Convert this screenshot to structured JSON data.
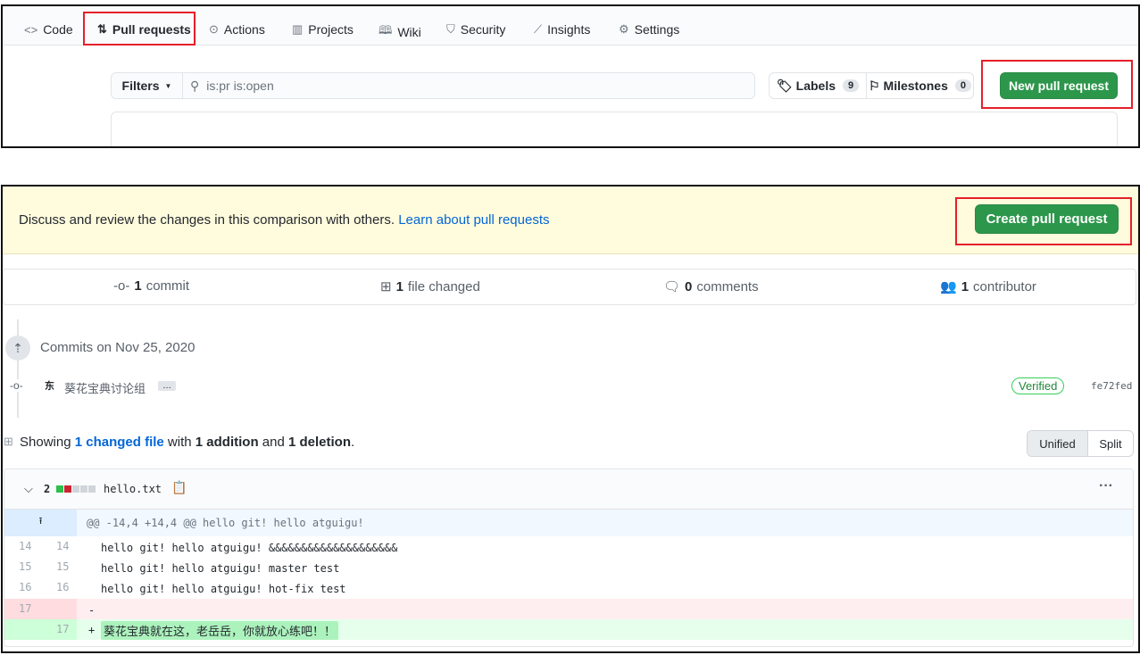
{
  "nav": {
    "tabs": [
      {
        "label": "Code",
        "icon": "code-icon"
      },
      {
        "label": "Pull requests",
        "icon": "git-pull-request-icon",
        "selected": true
      },
      {
        "label": "Actions",
        "icon": "play-icon"
      },
      {
        "label": "Projects",
        "icon": "project-icon"
      },
      {
        "label": "Wiki",
        "icon": "book-icon"
      },
      {
        "label": "Security",
        "icon": "shield-icon"
      },
      {
        "label": "Insights",
        "icon": "graph-icon"
      },
      {
        "label": "Settings",
        "icon": "gear-icon"
      }
    ]
  },
  "filters": {
    "label": "Filters",
    "search_value": "is:pr is:open"
  },
  "labels": {
    "label": "Labels",
    "count": "9"
  },
  "milestones": {
    "label": "Milestones",
    "count": "0"
  },
  "new_pr": "New pull request",
  "compare": {
    "banner_text": "Discuss and review the changes in this comparison with others.",
    "banner_link": "Learn about pull requests",
    "create_pr": "Create pull request"
  },
  "stats": {
    "commits_n": "1",
    "commits": "commit",
    "files_n": "1",
    "files": "file changed",
    "comments_n": "0",
    "comments": "comments",
    "contrib_n": "1",
    "contrib": "contributor"
  },
  "commits": {
    "header": "Commits on Nov 25, 2020",
    "author": "东",
    "message": "葵花宝典讨论组",
    "ellipsis": "…",
    "verified": "Verified",
    "sha": "fe72fed"
  },
  "summary": {
    "showing": "Showing",
    "changed": "1 changed file",
    "with": "with",
    "additions": "1 addition",
    "and": "and",
    "deletions": "1 deletion",
    "end": ".",
    "unified": "Unified",
    "split": "Split"
  },
  "file": {
    "changes": "2",
    "name": "hello.txt",
    "more": "···"
  },
  "diff": {
    "hunk": "@@ -14,4 +14,4 @@ hello git! hello atguigu!",
    "lines": [
      {
        "old": "14",
        "new": "14",
        "text": "hello git! hello atguigu! &&&&&&&&&&&&&&&&&&&&"
      },
      {
        "old": "15",
        "new": "15",
        "text": "hello git! hello atguigu! master test"
      },
      {
        "old": "16",
        "new": "16",
        "text": "hello git! hello atguigu! hot-fix test"
      },
      {
        "old": "17",
        "new": "",
        "marker": "-",
        "text": ""
      },
      {
        "old": "",
        "new": "17",
        "marker": "+",
        "text": "葵花宝典就在这，老岳岳，你就放心练吧！！"
      }
    ]
  },
  "colors": {
    "green": "#2c974b",
    "link": "#0366d6",
    "highlight": "#e5202a"
  }
}
